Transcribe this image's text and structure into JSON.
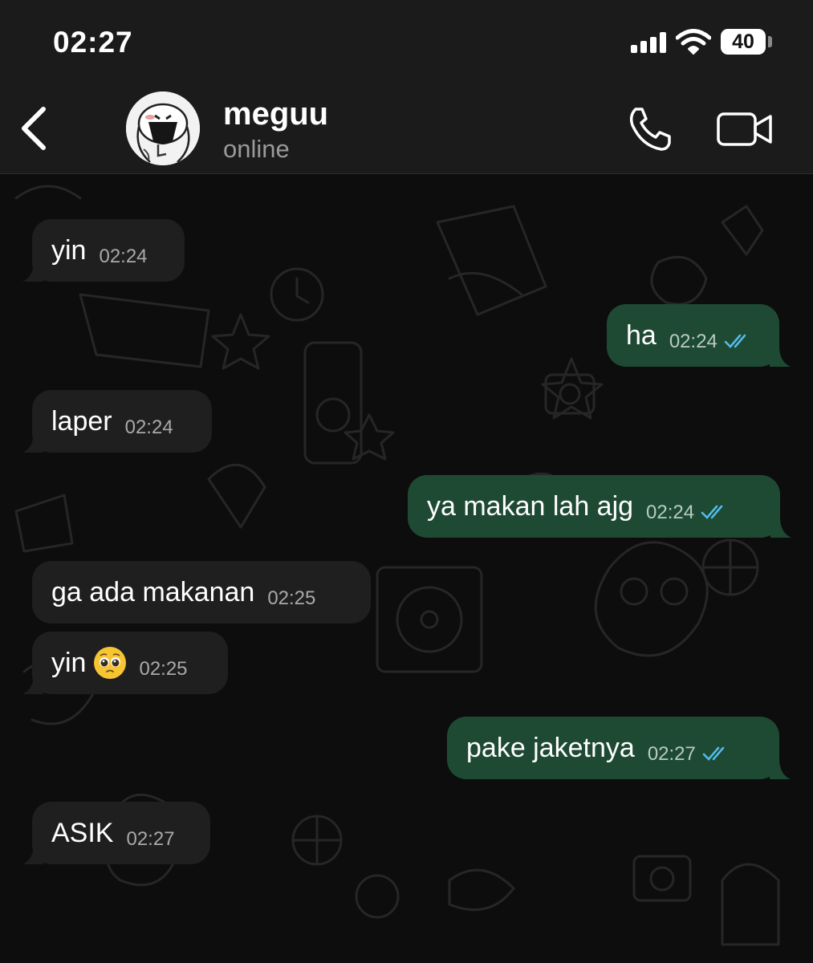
{
  "status_bar": {
    "time": "02:27",
    "battery_level": "40",
    "signal_icon": "cellular-signal-icon",
    "wifi_icon": "wifi-icon"
  },
  "header": {
    "contact_name": "meguu",
    "contact_status": "online",
    "icons": [
      "back-chevron-icon",
      "phone-call-icon",
      "video-call-icon"
    ]
  },
  "colors": {
    "incoming_bubble": "#1f1f1f",
    "outgoing_bubble": "#1e4a34",
    "read_ticks": "#53bdeb"
  },
  "messages": [
    {
      "direction": "incoming",
      "text": "yin",
      "time": "02:24"
    },
    {
      "direction": "outgoing",
      "text": "ha",
      "time": "02:24",
      "status": "read"
    },
    {
      "direction": "incoming",
      "text": "laper",
      "time": "02:24"
    },
    {
      "direction": "outgoing",
      "text": "ya makan lah ajg",
      "time": "02:24",
      "status": "read"
    },
    {
      "direction": "incoming",
      "text": "ga ada makanan",
      "time": "02:25"
    },
    {
      "direction": "incoming",
      "text": "yin",
      "emoji": "pleading-face",
      "time": "02:25"
    },
    {
      "direction": "outgoing",
      "text": "pake jaketnya",
      "time": "02:27",
      "status": "read"
    },
    {
      "direction": "incoming",
      "text": "ASIK",
      "time": "02:27"
    }
  ]
}
